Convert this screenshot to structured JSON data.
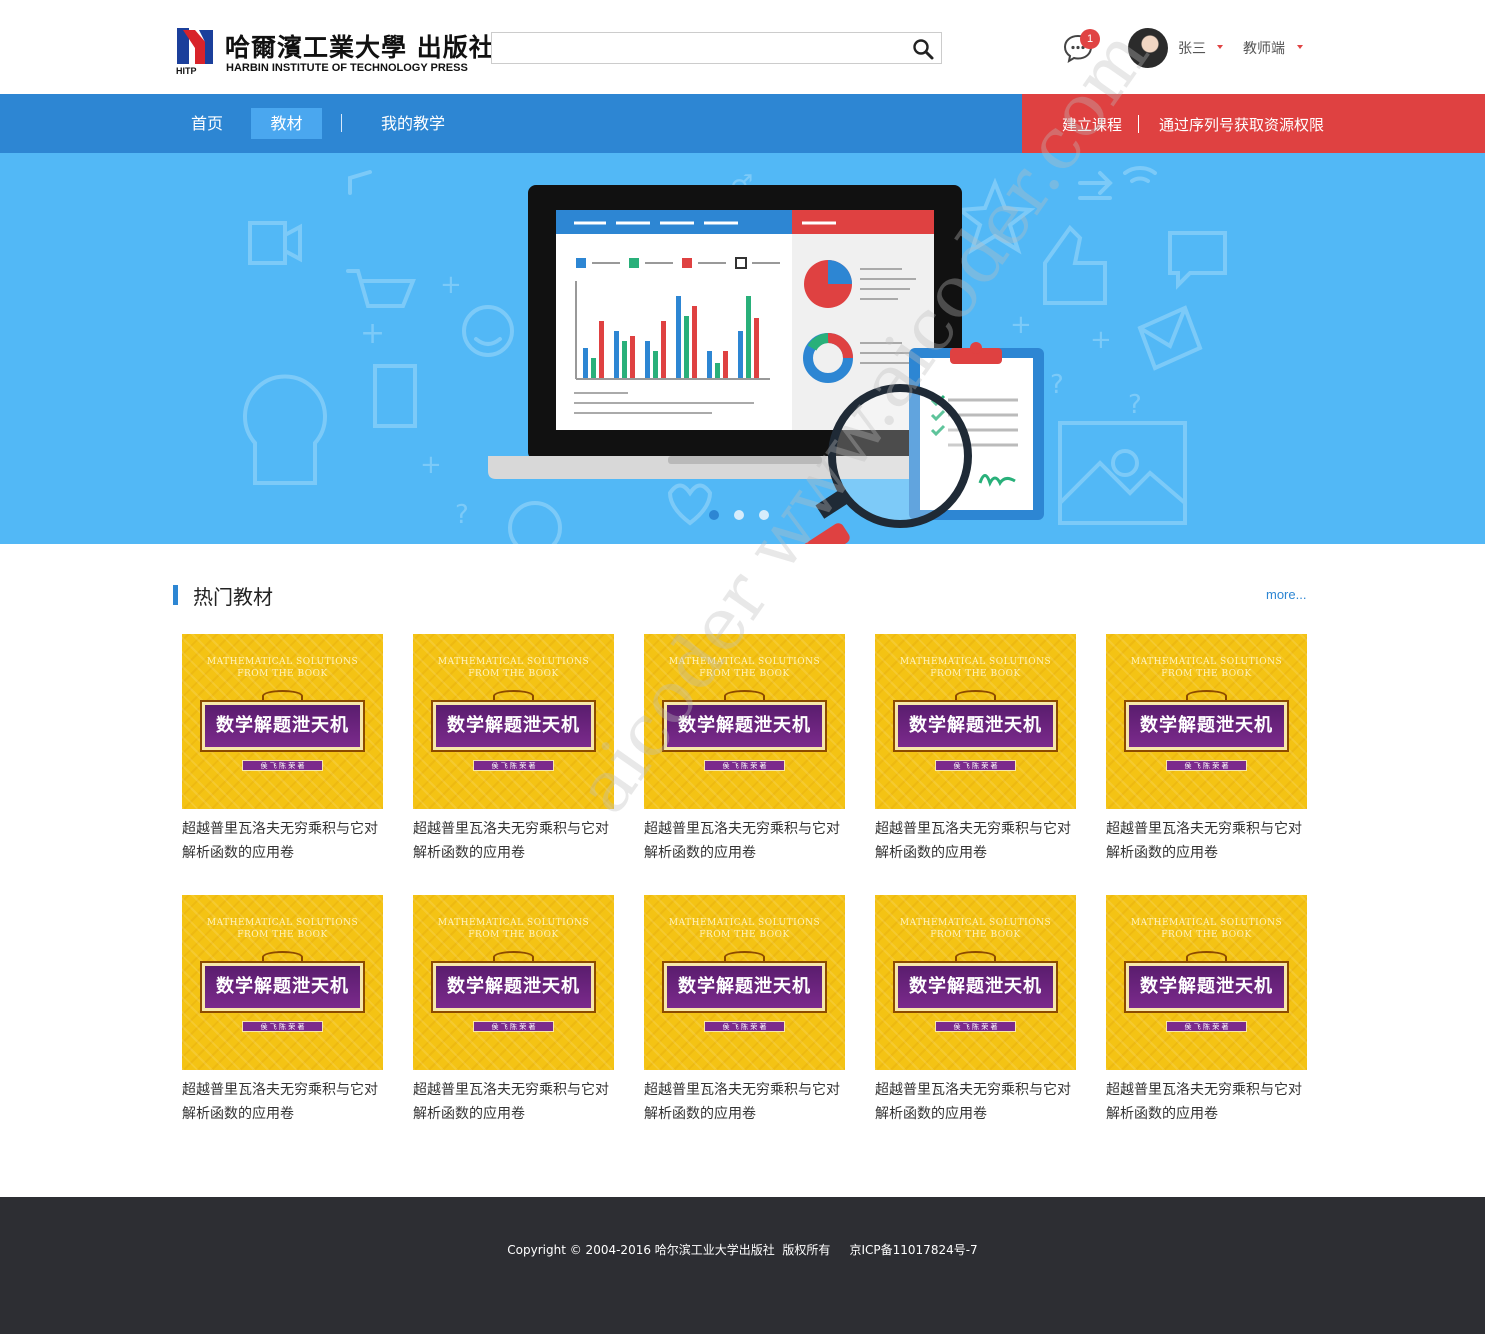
{
  "header": {
    "logo_cn": "哈爾濱工業大學 出版社",
    "logo_en": "HARBIN INSTITUTE OF TECHNOLOGY PRESS",
    "logo_mark": "HITP",
    "search_placeholder": "",
    "message_count": "1",
    "username": "张三",
    "role": "教师端"
  },
  "nav": {
    "items": [
      {
        "label": "首页"
      },
      {
        "label": "教材"
      },
      {
        "label": "我的教学"
      }
    ],
    "actions": [
      {
        "label": "建立课程"
      },
      {
        "label": "通过序列号获取资源权限"
      }
    ]
  },
  "banner": {
    "slide_count": 3,
    "active_slide": 1
  },
  "section": {
    "title": "热门教材",
    "more": "more..."
  },
  "books": [
    {
      "title": "超越普里瓦洛夫无穷乘积与它对解析函数的应用卷",
      "cover_en": "MATHEMATICAL SOLUTIONS\nFROM THE BOOK",
      "cover_cn": "数学解题泄天机",
      "cover_sub": "侯 飞 陈 荣 著"
    },
    {
      "title": "超越普里瓦洛夫无穷乘积与它对解析函数的应用卷",
      "cover_en": "MATHEMATICAL SOLUTIONS\nFROM THE BOOK",
      "cover_cn": "数学解题泄天机",
      "cover_sub": "侯 飞 陈 荣 著"
    },
    {
      "title": "超越普里瓦洛夫无穷乘积与它对解析函数的应用卷",
      "cover_en": "MATHEMATICAL SOLUTIONS\nFROM THE BOOK",
      "cover_cn": "数学解题泄天机",
      "cover_sub": "侯 飞 陈 荣 著"
    },
    {
      "title": "超越普里瓦洛夫无穷乘积与它对解析函数的应用卷",
      "cover_en": "MATHEMATICAL SOLUTIONS\nFROM THE BOOK",
      "cover_cn": "数学解题泄天机",
      "cover_sub": "侯 飞 陈 荣 著"
    },
    {
      "title": "超越普里瓦洛夫无穷乘积与它对解析函数的应用卷",
      "cover_en": "MATHEMATICAL SOLUTIONS\nFROM THE BOOK",
      "cover_cn": "数学解题泄天机",
      "cover_sub": "侯 飞 陈 荣 著"
    },
    {
      "title": "超越普里瓦洛夫无穷乘积与它对解析函数的应用卷",
      "cover_en": "MATHEMATICAL SOLUTIONS\nFROM THE BOOK",
      "cover_cn": "数学解题泄天机",
      "cover_sub": "侯 飞 陈 荣 著"
    },
    {
      "title": "超越普里瓦洛夫无穷乘积与它对解析函数的应用卷",
      "cover_en": "MATHEMATICAL SOLUTIONS\nFROM THE BOOK",
      "cover_cn": "数学解题泄天机",
      "cover_sub": "侯 飞 陈 荣 著"
    },
    {
      "title": "超越普里瓦洛夫无穷乘积与它对解析函数的应用卷",
      "cover_en": "MATHEMATICAL SOLUTIONS\nFROM THE BOOK",
      "cover_cn": "数学解题泄天机",
      "cover_sub": "侯 飞 陈 荣 著"
    },
    {
      "title": "超越普里瓦洛夫无穷乘积与它对解析函数的应用卷",
      "cover_en": "MATHEMATICAL SOLUTIONS\nFROM THE BOOK",
      "cover_cn": "数学解题泄天机",
      "cover_sub": "侯 飞 陈 荣 著"
    },
    {
      "title": "超越普里瓦洛夫无穷乘积与它对解析函数的应用卷",
      "cover_en": "MATHEMATICAL SOLUTIONS\nFROM THE BOOK",
      "cover_cn": "数学解题泄天机",
      "cover_sub": "侯 飞 陈 荣 著"
    }
  ],
  "watermark": "aicoder  www.aicoder.com",
  "footer": {
    "copyright": "Copyright © 2004-2016 哈尔滨工业大学出版社  版权所有     京ICP备11017824号-7"
  },
  "colors": {
    "nav_blue": "#2d86d3",
    "nav_active": "#4aa7ef",
    "nav_red": "#df4141",
    "banner": "#52b8f6",
    "cover_yellow": "#f4c314",
    "cover_purple": "#6b2380",
    "footer": "#2d2e33"
  },
  "icons": {
    "search": "magnifier-icon",
    "message": "chat-bubble-icon",
    "caret": "caret-down-icon"
  }
}
